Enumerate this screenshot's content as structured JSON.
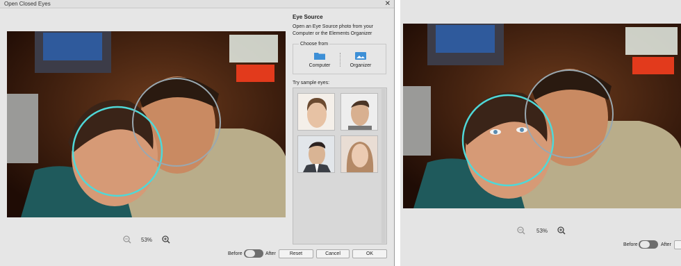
{
  "window_title": "Open Closed Eyes",
  "close_glyph": "✕",
  "zoom_level": "53%",
  "panel": {
    "title": "Eye Source",
    "description": "Open an Eye Source photo from your Computer or the Elements Organizer",
    "choose_from": "Choose from",
    "computer": "Computer",
    "organizer": "Organizer",
    "try_samples": "Try sample eyes:"
  },
  "footer": {
    "before": "Before",
    "after": "After",
    "reset": "Reset",
    "cancel": "Cancel",
    "ok": "OK"
  },
  "right_window": {
    "zoom_level": "53%",
    "before": "Before",
    "after": "After"
  },
  "colors": {
    "selection_circle": "#4fd8d8",
    "reference_circle": "#9aa8b0",
    "toggle": "#6d6d6d"
  }
}
